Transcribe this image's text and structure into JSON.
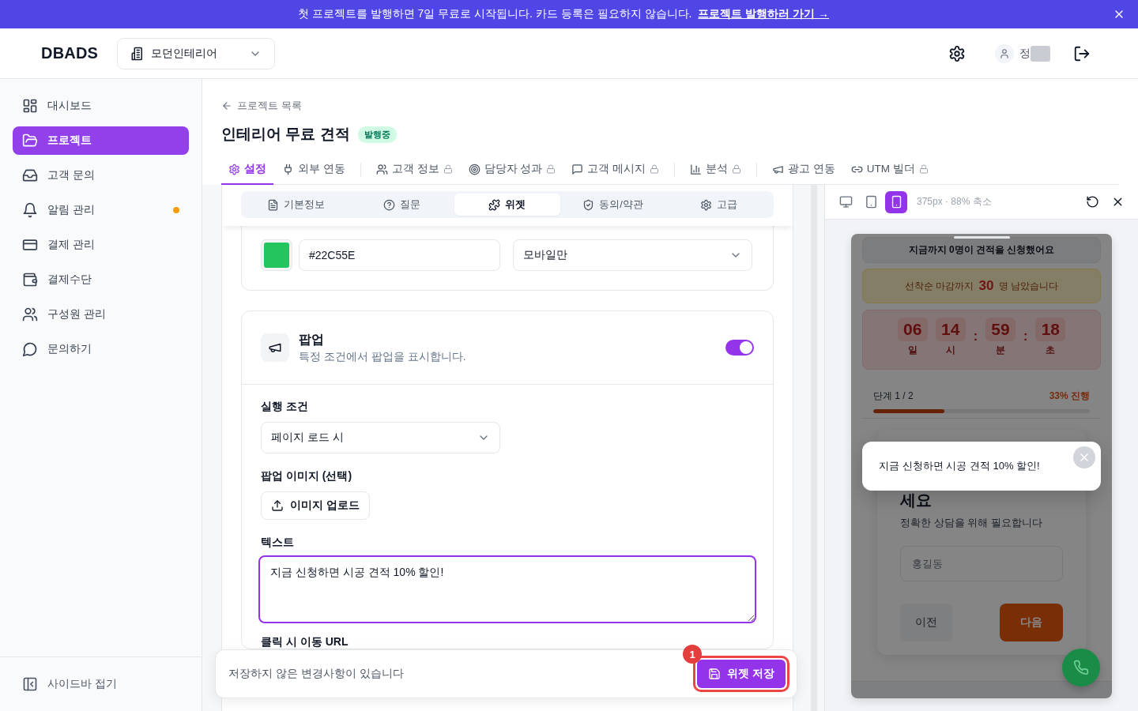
{
  "banner": {
    "text": "첫 프로젝트를 발행하면 7일 무료로 시작됩니다. 카드 등록은 필요하지 않습니다.",
    "link": "프로젝트 발행하러 가기 →"
  },
  "header": {
    "logo": "DBADS",
    "project_selector": "모던인테리어",
    "user_name": "정"
  },
  "sidebar": {
    "items": [
      {
        "label": "대시보드",
        "selected": false,
        "alert": false
      },
      {
        "label": "프로젝트",
        "selected": true,
        "alert": false
      },
      {
        "label": "고객 문의",
        "selected": false,
        "alert": false
      },
      {
        "label": "알림 관리",
        "selected": false,
        "alert": true
      },
      {
        "label": "결제 관리",
        "selected": false,
        "alert": false
      },
      {
        "label": "결제수단",
        "selected": false,
        "alert": false
      },
      {
        "label": "구성원 관리",
        "selected": false,
        "alert": false
      },
      {
        "label": "문의하기",
        "selected": false,
        "alert": false
      }
    ],
    "collapse": "사이드바 접기"
  },
  "page": {
    "back_link": "프로젝트 목록",
    "title": "인테리어 무료 견적",
    "status": "발행중"
  },
  "tab_groups": [
    [
      {
        "label": "설정",
        "selected": true,
        "locked": false
      },
      {
        "label": "외부 연동",
        "selected": false,
        "locked": false
      }
    ],
    [
      {
        "label": "고객 정보",
        "selected": false,
        "locked": true
      },
      {
        "label": "담당자 성과",
        "selected": false,
        "locked": true
      },
      {
        "label": "고객 메시지",
        "selected": false,
        "locked": true
      }
    ],
    [
      {
        "label": "분석",
        "selected": false,
        "locked": true
      }
    ],
    [
      {
        "label": "광고 연동",
        "selected": false,
        "locked": false
      },
      {
        "label": "UTM 빌더",
        "selected": false,
        "locked": true
      }
    ]
  ],
  "sub_tabs": [
    {
      "label": "기본정보",
      "selected": false
    },
    {
      "label": "질문",
      "selected": false
    },
    {
      "label": "위젯",
      "selected": true
    },
    {
      "label": "동의/약관",
      "selected": false
    },
    {
      "label": "고급",
      "selected": false
    }
  ],
  "appearance_card": {
    "color_value": "#22C55E",
    "select_value": "모바일만"
  },
  "popup_card": {
    "title": "팝업",
    "description": "특정 조건에서 팝업을 표시합니다.",
    "on": true,
    "trigger": {
      "label": "실행 조건",
      "value": "페이지 로드 시"
    },
    "image": {
      "label": "팝업 이미지 (선택)",
      "button": "이미지 업로드"
    },
    "text": {
      "label": "텍스트",
      "value": "지금 신청하면 시공 견적 10% 할인!",
      "focused": true
    },
    "url": {
      "label": "클릭 시 이동 URL"
    }
  },
  "save_bar": {
    "message": "저장하지 않은 변경사항이 있습니다",
    "button": "위젯 저장",
    "step_badge": "1"
  },
  "preview": {
    "devices": [
      {
        "selected": false
      },
      {
        "selected": false
      },
      {
        "selected": true
      }
    ],
    "info": "375px · 88% 축소",
    "phone": {
      "counter": "지금까지 0명이 견적을 신청했어요",
      "scarcity": "선착순 마감까지 **30** 명 남았습니다",
      "countdown": [
        {
          "value": "06",
          "unit": "일"
        },
        {
          "value": "14",
          "unit": "시"
        },
        {
          "value": "59",
          "unit": "분",
          "separator": ":"
        },
        {
          "value": "18",
          "unit": "초",
          "separator": ":"
        }
      ],
      "progress": {
        "step": "단계 1 / 2",
        "percent": "33% 진행",
        "level": 0.33
      },
      "form": {
        "heading": "세요",
        "description": "정확한 상담을 위해 필요합니다",
        "placeholder": "홍길동",
        "prev": {
          "label": "이전",
          "disabled": true
        },
        "next": {
          "label": "다음",
          "disabled": false
        }
      },
      "popup": {
        "text": "지금 신청하면 시공 견적 10% 할인!"
      }
    }
  }
}
